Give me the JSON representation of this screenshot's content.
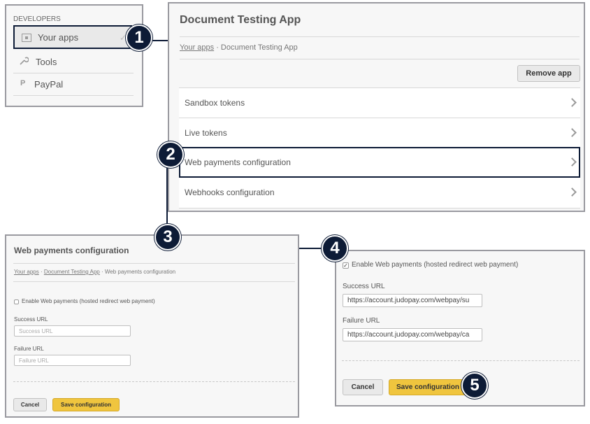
{
  "sidebar": {
    "section_label": "DEVELOPERS",
    "items": [
      {
        "label": "Your apps",
        "icon": "app-window-icon",
        "selected": true
      },
      {
        "label": "Tools",
        "icon": "wrench-icon",
        "selected": false
      },
      {
        "label": "PayPal",
        "icon": "paypal-icon",
        "selected": false
      }
    ]
  },
  "app_panel": {
    "title": "Document Testing App",
    "breadcrumb": {
      "link": "Your apps",
      "separator": " · ",
      "current": "Document Testing App"
    },
    "remove_button": "Remove app",
    "menu": [
      "Sandbox tokens",
      "Live tokens",
      "Web payments configuration",
      "Webhooks configuration"
    ]
  },
  "webpay_panel": {
    "title": "Web payments configuration",
    "breadcrumb": {
      "link1": "Your apps",
      "sep": " · ",
      "link2": "Document Testing App",
      "current": "Web payments configuration"
    },
    "checkbox_label": "Enable Web payments (hosted redirect web payment)",
    "success_label": "Success URL",
    "success_placeholder": "Success URL",
    "failure_label": "Failure URL",
    "failure_placeholder": "Failure URL",
    "cancel": "Cancel",
    "save": "Save configuration"
  },
  "filled_panel": {
    "checkbox_label": "Enable Web payments (hosted redirect web payment)",
    "checked": true,
    "success_label": "Success URL",
    "success_value": "https://account.judopay.com/webpay/su",
    "failure_label": "Failure URL",
    "failure_value": "https://account.judopay.com/webpay/ca",
    "cancel": "Cancel",
    "save": "Save configuration"
  },
  "callouts": [
    "1",
    "2",
    "3",
    "4",
    "5"
  ],
  "colors": {
    "callout": "#0d1b36",
    "accent_button": "#f0c53e",
    "panel_border": "#9a9aa0"
  }
}
